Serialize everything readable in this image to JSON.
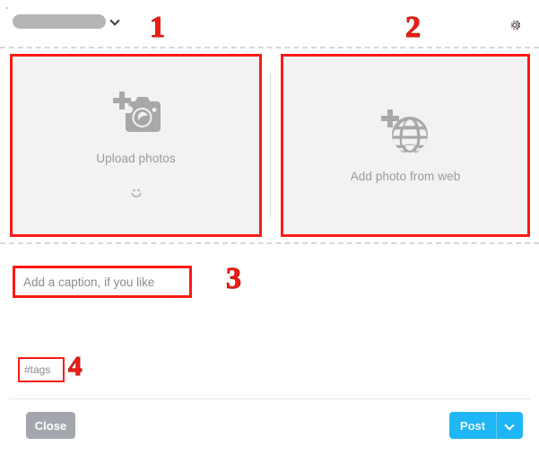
{
  "header": {
    "account_name_redacted": "",
    "account_chevron_icon": "chevron-down-icon",
    "settings_icon": "gear-icon"
  },
  "media": {
    "upload_panel": {
      "icon": "camera-plus-icon",
      "label": "Upload photos",
      "emoji_icon": "smiley-face-icon"
    },
    "web_panel": {
      "icon": "globe-plus-icon",
      "label": "Add photo from web"
    }
  },
  "caption": {
    "value": "",
    "placeholder": "Add a caption, if you like"
  },
  "tags": {
    "value": "",
    "placeholder": "#tags"
  },
  "footer": {
    "close_label": "Close",
    "post_label": "Post",
    "post_caret_icon": "chevron-down-icon"
  },
  "annotations": [
    {
      "id": "annotation-1",
      "label": "1"
    },
    {
      "id": "annotation-2",
      "label": "2"
    },
    {
      "id": "annotation-3",
      "label": "3"
    },
    {
      "id": "annotation-4",
      "label": "4"
    }
  ],
  "colors": {
    "annotation_red": "#ee1c12",
    "highlight_box_red": "#fc1b14",
    "panel_background": "#f2f2f2",
    "post_button_blue": "#1fb6f5",
    "close_button_grey": "#a3a7ad",
    "placeholder_grey": "#8c8c8c"
  }
}
